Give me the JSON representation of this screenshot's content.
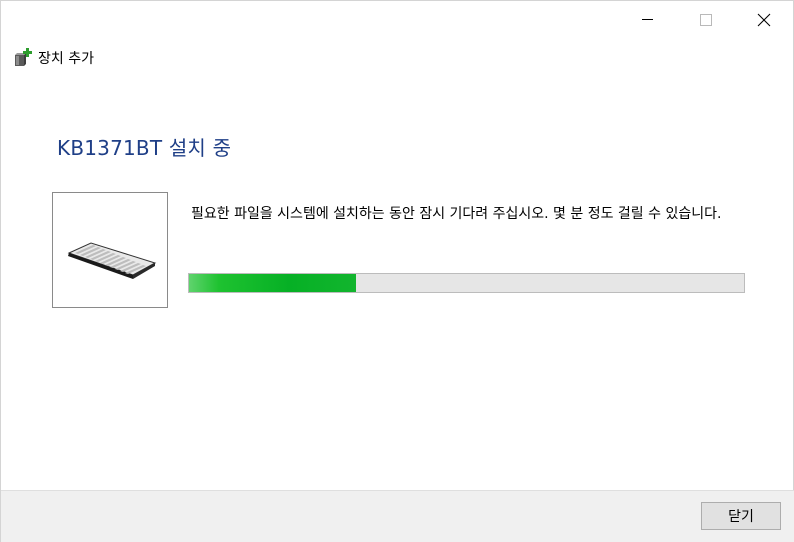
{
  "window": {
    "title": "장치 추가",
    "title_icon": "add-device-icon",
    "controls": {
      "minimize_icon": "minimize-icon",
      "maximize_icon": "maximize-icon",
      "close_icon": "close-icon"
    }
  },
  "main": {
    "heading": "KB1371BT 설치 중",
    "device_image": "keyboard-icon",
    "message": "필요한 파일을 시스템에 설치하는 동안 잠시 기다려 주십시오. 몇 분 정도 걸릴 수 있습니다.",
    "progress": 0.3
  },
  "footer": {
    "close_label": "닫기"
  },
  "colors": {
    "heading": "#1f3f87",
    "progress_fill": "#06b025",
    "footer_bg": "#f0f0f0"
  }
}
